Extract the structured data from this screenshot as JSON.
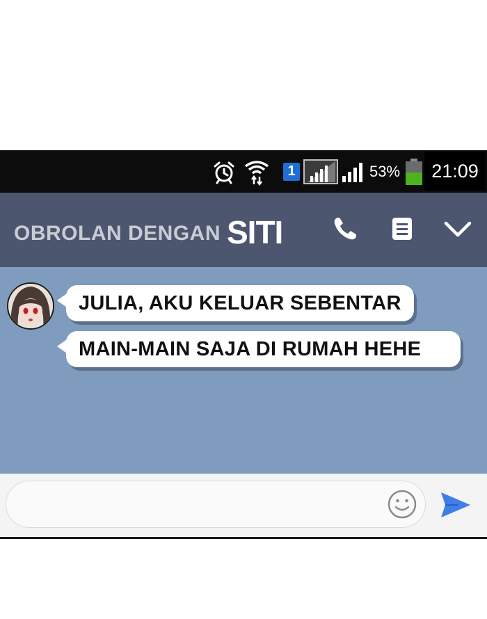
{
  "status_bar": {
    "sim_slot": "1",
    "battery_percent": "53%",
    "battery_level": 0.53,
    "time": "21:09",
    "icons": [
      "alarm-icon",
      "wifi-icon",
      "sim-icon",
      "signal-icon",
      "battery-icon"
    ]
  },
  "header": {
    "title_prefix": "OBROLAN DENGAN",
    "contact_name": "SITI",
    "icons": [
      "phone-icon",
      "menu-icon",
      "chevron-down-icon"
    ]
  },
  "messages": [
    {
      "text": "JULIA, AKU KELUAR SEBENTAR"
    },
    {
      "text": "MAIN-MAIN SAJA DI RUMAH HEHE"
    }
  ],
  "input": {
    "value": "",
    "placeholder": ""
  },
  "colors": {
    "header_bg": "#4c566f",
    "chat_bg": "#7f9cbf",
    "send_accent": "#3f7ee8",
    "battery_green": "#4fb21f"
  }
}
